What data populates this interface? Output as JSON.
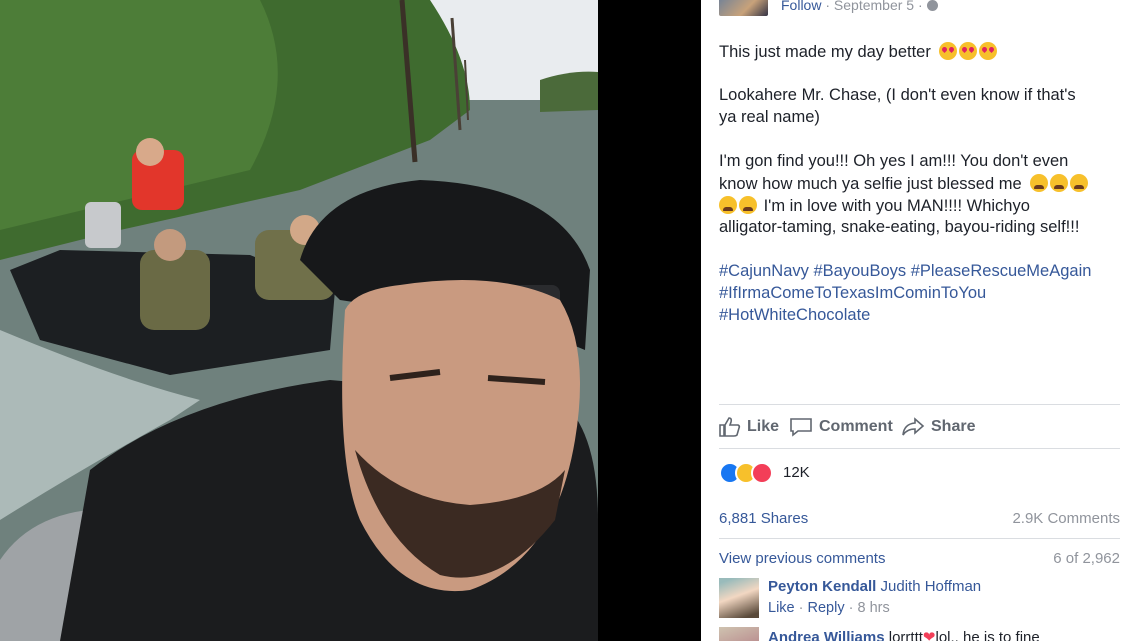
{
  "header": {
    "follow_label": "Follow",
    "date": "September 5",
    "separator": "·"
  },
  "post": {
    "line1": "This just made my day better",
    "para2_line1": "Lookahere Mr. Chase, (I don't even know if that's",
    "para2_line2": "ya real name)",
    "para3_line1": "I'm gon find you!!! Oh yes I am!!! You don't even",
    "para3_line2": "know how much ya selfie just blessed me",
    "para3_line3": "I'm in love with you MAN!!!! Whichyo",
    "para3_line4": "alligator-taming, snake-eating, bayou-riding self!!!",
    "hashtags_line1": [
      "#CajunNavy",
      "#BayouBoys",
      "#PleaseRescueMeAgain"
    ],
    "hashtags_line2": "#IfIrmaComeToTexasImCominToYou",
    "hashtags_line3": "#HotWhiteChocolate"
  },
  "actions": {
    "like": "Like",
    "comment": "Comment",
    "share": "Share"
  },
  "stats": {
    "reaction_count": "12K",
    "shares": "6,881 Shares",
    "comments": "2.9K Comments"
  },
  "comments": {
    "view_previous": "View previous comments",
    "pager": "6 of 2,962",
    "items": [
      {
        "author": "Peyton Kendall",
        "text": "Judith Hoffman",
        "like": "Like",
        "reply": "Reply",
        "time": "8 hrs"
      },
      {
        "author": "Andrea Williams",
        "text_before": "lorrttt",
        "text_after": "lol.. he is to fine"
      }
    ]
  },
  "colors": {
    "link_blue": "#365899",
    "text_dark": "#1d2129",
    "meta_grey": "#90949c",
    "action_grey": "#616770"
  },
  "icons": [
    "globe-icon",
    "heart-eyes-emoji",
    "tired-face-emoji",
    "thumbs-up-icon",
    "speech-bubble-icon",
    "share-arrow-icon",
    "like-reaction-icon",
    "haha-reaction-icon",
    "love-reaction-icon",
    "heart-emoji"
  ]
}
